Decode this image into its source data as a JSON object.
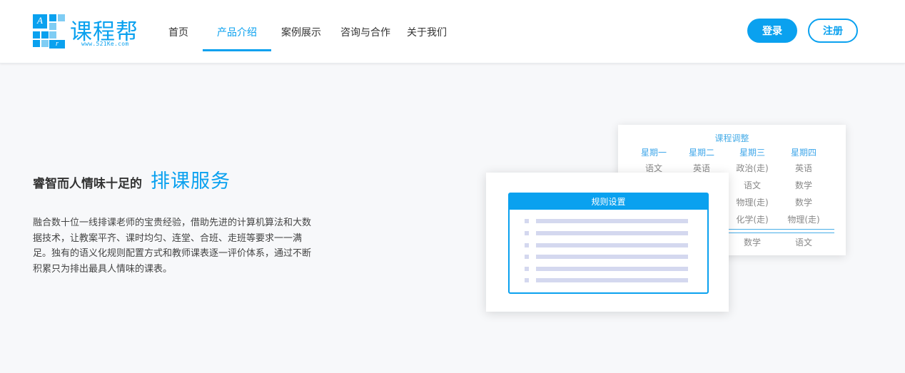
{
  "logo": {
    "grid_letters": [
      "A",
      "r"
    ],
    "name": "课程帮",
    "url": "www.521Ke.com"
  },
  "nav": {
    "items": [
      {
        "label": "首页",
        "active": false
      },
      {
        "label": "产品介绍",
        "active": true
      },
      {
        "label": "案例展示",
        "active": false
      },
      {
        "label": "咨询与合作",
        "active": false
      },
      {
        "label": "关于我们",
        "active": false
      }
    ]
  },
  "auth": {
    "login_label": "登录",
    "register_label": "注册"
  },
  "hero": {
    "title_small": "睿智而人情味十足的",
    "title_big": "排课服务",
    "description": "融合数十位一线排课老师的宝贵经验，借助先进的计算机算法和大数据技术，让教案平齐、课时均匀、连堂、合班、走班等要求一一满足。独有的语义化规则配置方式和教师课表逐一评价体系，通过不断积累只为排出最具人情味的课表。"
  },
  "schedule_card": {
    "title": "课程调整",
    "days": [
      "星期一",
      "星期二",
      "星期三",
      "星期四"
    ],
    "rows": [
      [
        "语文",
        "英语",
        "政治(走)",
        "英语"
      ],
      [
        "",
        "",
        "语文",
        "数学"
      ],
      [
        "",
        "",
        "物理(走)",
        "数学"
      ],
      [
        "",
        "",
        "化学(走)",
        "物理(走)"
      ],
      [
        "",
        "",
        "数学",
        "语文"
      ]
    ]
  },
  "rule_card": {
    "title": "规则设置"
  },
  "colors": {
    "accent": "#0aa1ef",
    "background": "#f7f8fa",
    "placeholder_bar": "#d4d8ef"
  }
}
